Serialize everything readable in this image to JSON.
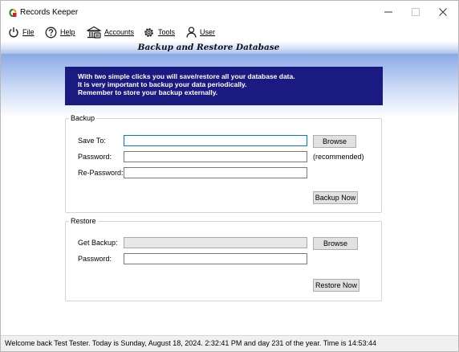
{
  "window": {
    "title": "Records Keeper",
    "minimize_icon": "minimize-icon",
    "maximize_icon": "maximize-icon",
    "close_icon": "close-icon"
  },
  "menu": {
    "items": [
      {
        "label": "File",
        "icon": "power-icon"
      },
      {
        "label": "Help",
        "icon": "help-circle-icon"
      },
      {
        "label": "Accounts",
        "icon": "accounts-icon"
      },
      {
        "label": "Tools",
        "icon": "gear-icon"
      },
      {
        "label": "User",
        "icon": "user-icon"
      }
    ]
  },
  "banner": {
    "title": "Backup and Restore Database"
  },
  "info": {
    "lines": [
      "With two simple clicks you will save/restore all your database data.",
      "It is very important to backup your data periodically.",
      "Remember to store your backup externally."
    ]
  },
  "backup": {
    "legend": "Backup",
    "save_to_label": "Save To:",
    "save_to_value": "",
    "password_label": "Password:",
    "password_value": "",
    "password_hint": "(recommended)",
    "repassword_label": "Re-Password:",
    "repassword_value": "",
    "browse_label": "Browse",
    "backup_now_label": "Backup Now"
  },
  "restore": {
    "legend": "Restore",
    "get_backup_label": "Get Backup:",
    "get_backup_value": "",
    "password_label": "Password:",
    "password_value": "",
    "browse_label": "Browse",
    "restore_now_label": "Restore Now"
  },
  "status": {
    "text": "Welcome back Test Tester.   Today is Sunday, August 18, 2024. 2:32:41 PM and day 231 of the year.   Time is 14:53:44"
  },
  "colors": {
    "info_background": "#1a1a80",
    "accent": "#0078d7",
    "banner_gradient_end": "#aac0ec"
  }
}
